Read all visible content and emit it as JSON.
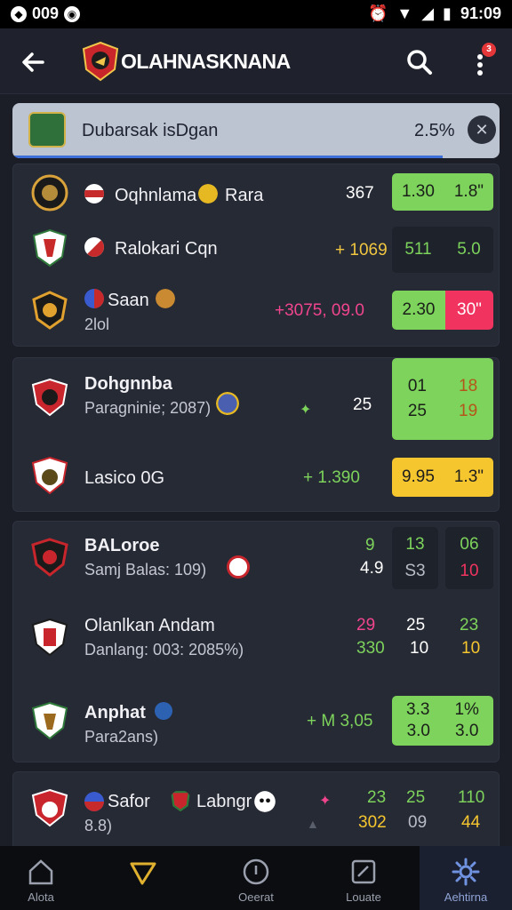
{
  "status_bar": {
    "left_text": "009",
    "time": "91:09"
  },
  "app_bar": {
    "title": "OLAHNASKNANA",
    "notification_count": "3"
  },
  "search": {
    "query": "Dubarsak isDgan",
    "percent": "2.5%"
  },
  "cards": [
    {
      "rows": [
        {
          "team": "Oqhnlama",
          "team2": "Rara",
          "value": "367",
          "odd1": "1.30",
          "odd2": "1.8\""
        },
        {
          "team": "Ralokari Cqn",
          "value": "+ 1069",
          "odd1": "511",
          "odd2": "5.0"
        },
        {
          "team": "Saan",
          "sub": "2lol",
          "value": "+3075, 09.0",
          "odd1": "2.30",
          "odd2": "30\""
        }
      ]
    },
    {
      "rows": [
        {
          "team": "Dohgnnba",
          "sub": "Paragninie; 2087)",
          "value": "25",
          "odd1a": "01",
          "odd1b": "25",
          "odd2a": "18",
          "odd2b": "19"
        },
        {
          "team": "Lasico 0G",
          "value": "+ 1.390",
          "odd1": "9.95",
          "odd2": "1.3\""
        }
      ]
    },
    {
      "rows": [
        {
          "team": "BALoroe",
          "sub": "Samj Balas: 109)",
          "v1a": "9",
          "v1b": "4.9",
          "v2a": "13",
          "v2b": "S3",
          "v3a": "06",
          "v3b": "10"
        },
        {
          "team": "Olanlkan Andam",
          "sub": "Danlang: 003: 2085%)",
          "v1a": "29",
          "v1b": "330",
          "v2a": "25",
          "v2b": "10",
          "v3a": "23",
          "v3b": "10"
        },
        {
          "team": "Anphat",
          "sub": "Para2ans)",
          "value": "+ M 3,05",
          "odd1a": "3.3",
          "odd1b": "3.0",
          "odd2a": "1%",
          "odd2b": "3.0"
        }
      ]
    },
    {
      "rows": [
        {
          "team": "Safor",
          "team2": "Labngr",
          "sub": "8.8)",
          "v1a": "23",
          "v1b": "302",
          "v2a": "25",
          "v2b": "09",
          "v3a": "110",
          "v3b": "44"
        }
      ]
    }
  ],
  "bottom_nav": [
    {
      "label": "Alota",
      "icon": "home-icon"
    },
    {
      "label": "",
      "icon": "send-icon"
    },
    {
      "label": "Oeerat",
      "icon": "compass-icon"
    },
    {
      "label": "Louate",
      "icon": "edit-icon"
    },
    {
      "label": "Aehtirna",
      "icon": "settings-icon"
    }
  ],
  "colors": {
    "green": "#7dd35b",
    "pink": "#f0345f",
    "yellow": "#f6c62f",
    "accent": "#3d6fd8"
  }
}
